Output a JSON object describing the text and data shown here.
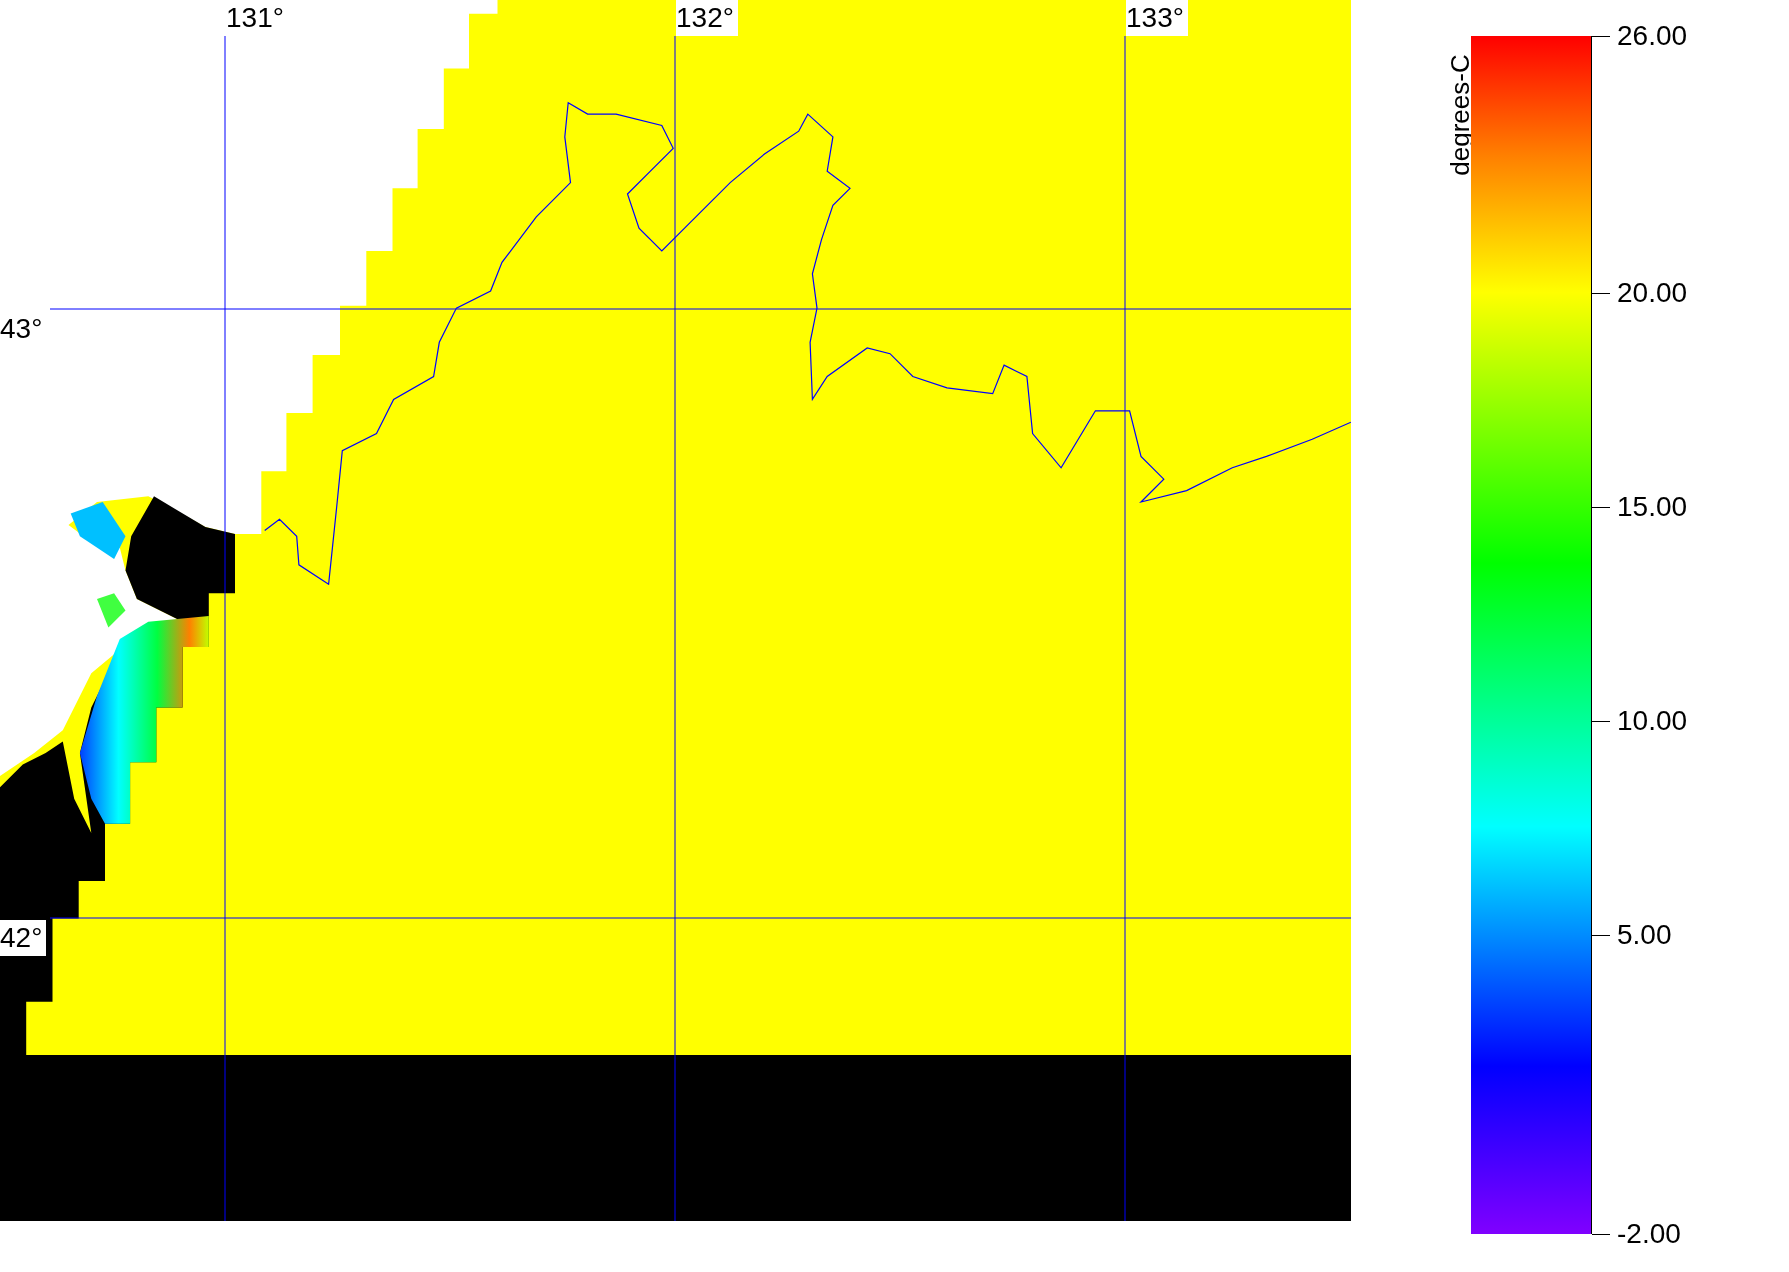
{
  "map": {
    "longitude_labels": [
      "131°",
      "132°",
      "133°"
    ],
    "latitude_labels": [
      "43°",
      "42°"
    ]
  },
  "colorbar": {
    "title": "degrees-C",
    "ticks": [
      "26.00",
      "20.00",
      "15.00",
      "10.00",
      "5.00",
      "-2.00"
    ]
  }
}
